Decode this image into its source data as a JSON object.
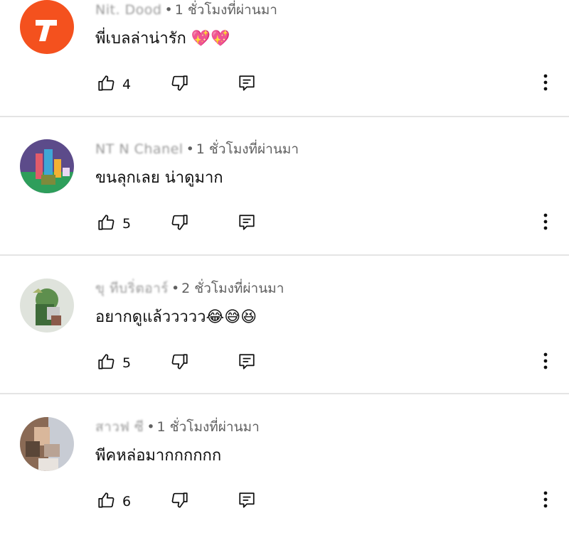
{
  "comments": [
    {
      "author": "Nit. Dood",
      "time": "1 ชั่วโมงที่ผ่านมา",
      "text": "พี่เบลล่าน่ารัก 💖💖",
      "likes": "4",
      "avatar_color": "#f4511e"
    },
    {
      "author": "NT N Chanel",
      "time": "1 ชั่วโมงที่ผ่านมา",
      "text": "ขนลุกเลย น่าดูมาก",
      "likes": "5",
      "avatar_color": "#5c4b8a"
    },
    {
      "author": "ขุ       ทีบริ่ตอาร์",
      "time": "2 ชั่วโมงที่ผ่านมา",
      "text": "อยากดูแล้ววววว😂😅😆",
      "likes": "5",
      "avatar_color": "#dfe3dc"
    },
    {
      "author": "สาวฟ     ซี",
      "time": "1 ชั่วโมงที่ผ่านมา",
      "text": "พีคหล่อมากกกกกก",
      "likes": "6",
      "avatar_color": "#8a6a55"
    }
  ],
  "icons": {
    "like": "thumb-up-icon",
    "dislike": "thumb-down-icon",
    "reply": "reply-icon",
    "more": "more-vert-icon"
  },
  "colors": {
    "divider": "#e4e4e4",
    "meta": "#606060"
  }
}
